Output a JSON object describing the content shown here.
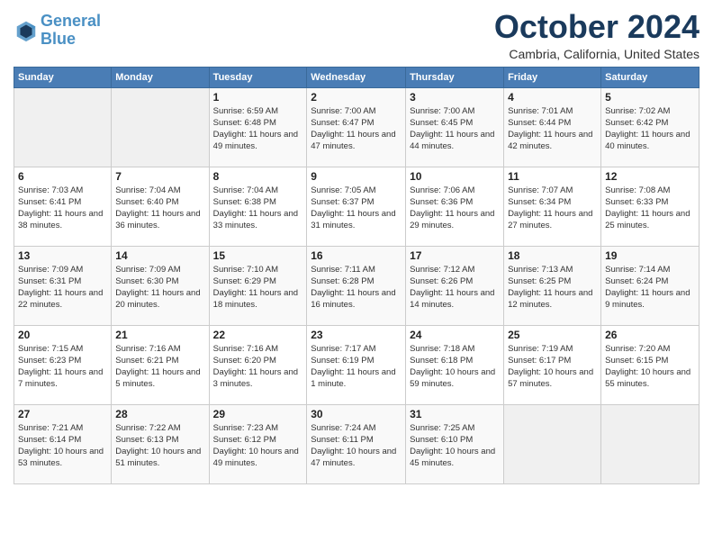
{
  "logo": {
    "line1": "General",
    "line2": "Blue"
  },
  "title": "October 2024",
  "location": "Cambria, California, United States",
  "days_header": [
    "Sunday",
    "Monday",
    "Tuesday",
    "Wednesday",
    "Thursday",
    "Friday",
    "Saturday"
  ],
  "weeks": [
    [
      {
        "day": "",
        "sunrise": "",
        "sunset": "",
        "daylight": ""
      },
      {
        "day": "",
        "sunrise": "",
        "sunset": "",
        "daylight": ""
      },
      {
        "day": "1",
        "sunrise": "Sunrise: 6:59 AM",
        "sunset": "Sunset: 6:48 PM",
        "daylight": "Daylight: 11 hours and 49 minutes."
      },
      {
        "day": "2",
        "sunrise": "Sunrise: 7:00 AM",
        "sunset": "Sunset: 6:47 PM",
        "daylight": "Daylight: 11 hours and 47 minutes."
      },
      {
        "day": "3",
        "sunrise": "Sunrise: 7:00 AM",
        "sunset": "Sunset: 6:45 PM",
        "daylight": "Daylight: 11 hours and 44 minutes."
      },
      {
        "day": "4",
        "sunrise": "Sunrise: 7:01 AM",
        "sunset": "Sunset: 6:44 PM",
        "daylight": "Daylight: 11 hours and 42 minutes."
      },
      {
        "day": "5",
        "sunrise": "Sunrise: 7:02 AM",
        "sunset": "Sunset: 6:42 PM",
        "daylight": "Daylight: 11 hours and 40 minutes."
      }
    ],
    [
      {
        "day": "6",
        "sunrise": "Sunrise: 7:03 AM",
        "sunset": "Sunset: 6:41 PM",
        "daylight": "Daylight: 11 hours and 38 minutes."
      },
      {
        "day": "7",
        "sunrise": "Sunrise: 7:04 AM",
        "sunset": "Sunset: 6:40 PM",
        "daylight": "Daylight: 11 hours and 36 minutes."
      },
      {
        "day": "8",
        "sunrise": "Sunrise: 7:04 AM",
        "sunset": "Sunset: 6:38 PM",
        "daylight": "Daylight: 11 hours and 33 minutes."
      },
      {
        "day": "9",
        "sunrise": "Sunrise: 7:05 AM",
        "sunset": "Sunset: 6:37 PM",
        "daylight": "Daylight: 11 hours and 31 minutes."
      },
      {
        "day": "10",
        "sunrise": "Sunrise: 7:06 AM",
        "sunset": "Sunset: 6:36 PM",
        "daylight": "Daylight: 11 hours and 29 minutes."
      },
      {
        "day": "11",
        "sunrise": "Sunrise: 7:07 AM",
        "sunset": "Sunset: 6:34 PM",
        "daylight": "Daylight: 11 hours and 27 minutes."
      },
      {
        "day": "12",
        "sunrise": "Sunrise: 7:08 AM",
        "sunset": "Sunset: 6:33 PM",
        "daylight": "Daylight: 11 hours and 25 minutes."
      }
    ],
    [
      {
        "day": "13",
        "sunrise": "Sunrise: 7:09 AM",
        "sunset": "Sunset: 6:31 PM",
        "daylight": "Daylight: 11 hours and 22 minutes."
      },
      {
        "day": "14",
        "sunrise": "Sunrise: 7:09 AM",
        "sunset": "Sunset: 6:30 PM",
        "daylight": "Daylight: 11 hours and 20 minutes."
      },
      {
        "day": "15",
        "sunrise": "Sunrise: 7:10 AM",
        "sunset": "Sunset: 6:29 PM",
        "daylight": "Daylight: 11 hours and 18 minutes."
      },
      {
        "day": "16",
        "sunrise": "Sunrise: 7:11 AM",
        "sunset": "Sunset: 6:28 PM",
        "daylight": "Daylight: 11 hours and 16 minutes."
      },
      {
        "day": "17",
        "sunrise": "Sunrise: 7:12 AM",
        "sunset": "Sunset: 6:26 PM",
        "daylight": "Daylight: 11 hours and 14 minutes."
      },
      {
        "day": "18",
        "sunrise": "Sunrise: 7:13 AM",
        "sunset": "Sunset: 6:25 PM",
        "daylight": "Daylight: 11 hours and 12 minutes."
      },
      {
        "day": "19",
        "sunrise": "Sunrise: 7:14 AM",
        "sunset": "Sunset: 6:24 PM",
        "daylight": "Daylight: 11 hours and 9 minutes."
      }
    ],
    [
      {
        "day": "20",
        "sunrise": "Sunrise: 7:15 AM",
        "sunset": "Sunset: 6:23 PM",
        "daylight": "Daylight: 11 hours and 7 minutes."
      },
      {
        "day": "21",
        "sunrise": "Sunrise: 7:16 AM",
        "sunset": "Sunset: 6:21 PM",
        "daylight": "Daylight: 11 hours and 5 minutes."
      },
      {
        "day": "22",
        "sunrise": "Sunrise: 7:16 AM",
        "sunset": "Sunset: 6:20 PM",
        "daylight": "Daylight: 11 hours and 3 minutes."
      },
      {
        "day": "23",
        "sunrise": "Sunrise: 7:17 AM",
        "sunset": "Sunset: 6:19 PM",
        "daylight": "Daylight: 11 hours and 1 minute."
      },
      {
        "day": "24",
        "sunrise": "Sunrise: 7:18 AM",
        "sunset": "Sunset: 6:18 PM",
        "daylight": "Daylight: 10 hours and 59 minutes."
      },
      {
        "day": "25",
        "sunrise": "Sunrise: 7:19 AM",
        "sunset": "Sunset: 6:17 PM",
        "daylight": "Daylight: 10 hours and 57 minutes."
      },
      {
        "day": "26",
        "sunrise": "Sunrise: 7:20 AM",
        "sunset": "Sunset: 6:15 PM",
        "daylight": "Daylight: 10 hours and 55 minutes."
      }
    ],
    [
      {
        "day": "27",
        "sunrise": "Sunrise: 7:21 AM",
        "sunset": "Sunset: 6:14 PM",
        "daylight": "Daylight: 10 hours and 53 minutes."
      },
      {
        "day": "28",
        "sunrise": "Sunrise: 7:22 AM",
        "sunset": "Sunset: 6:13 PM",
        "daylight": "Daylight: 10 hours and 51 minutes."
      },
      {
        "day": "29",
        "sunrise": "Sunrise: 7:23 AM",
        "sunset": "Sunset: 6:12 PM",
        "daylight": "Daylight: 10 hours and 49 minutes."
      },
      {
        "day": "30",
        "sunrise": "Sunrise: 7:24 AM",
        "sunset": "Sunset: 6:11 PM",
        "daylight": "Daylight: 10 hours and 47 minutes."
      },
      {
        "day": "31",
        "sunrise": "Sunrise: 7:25 AM",
        "sunset": "Sunset: 6:10 PM",
        "daylight": "Daylight: 10 hours and 45 minutes."
      },
      {
        "day": "",
        "sunrise": "",
        "sunset": "",
        "daylight": ""
      },
      {
        "day": "",
        "sunrise": "",
        "sunset": "",
        "daylight": ""
      }
    ]
  ]
}
